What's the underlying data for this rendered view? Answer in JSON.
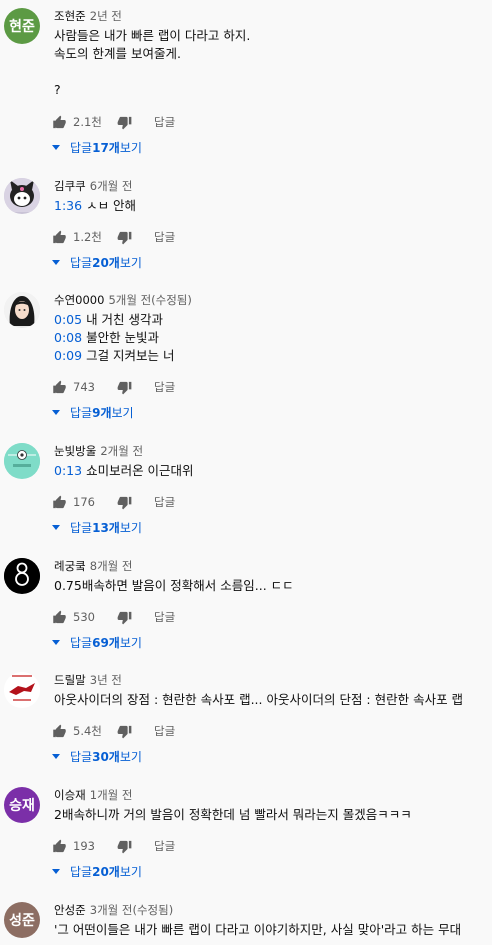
{
  "labels": {
    "reply": "답글",
    "view_replies_prefix": "답글 ",
    "view_replies_suffix": " 보기"
  },
  "colors": {
    "link": "#065fd4",
    "muted": "#606060",
    "background": "#f9f9f9"
  },
  "comments": [
    {
      "avatar_text": "현준",
      "avatar_color": "#5c9a44",
      "author": "조현준",
      "time": "2년 전",
      "lines": [
        {
          "ts": "",
          "text": "사람들은 내가 빠른 랩이 다라고 하지."
        },
        {
          "ts": "",
          "text": "속도의 한계를 보여줄게."
        },
        {
          "ts": "",
          "text": ""
        },
        {
          "ts": "",
          "text": "?"
        }
      ],
      "likes": "2.1천",
      "replies": "17개"
    },
    {
      "avatar_text": "",
      "avatar_icon": "kuromi-avatar-icon",
      "avatar_color": "#c9c3d6",
      "author": "김쿠쿠",
      "time": "6개월 전",
      "lines": [
        {
          "ts": "1:36",
          "text": "ㅅㅂ 안해"
        }
      ],
      "likes": "1.2천",
      "replies": "20개"
    },
    {
      "avatar_text": "",
      "avatar_icon": "anime-girl-avatar-icon",
      "avatar_color": "#e8e8e8",
      "author": "수연0000",
      "time": "5개월 전(수정됨)",
      "lines": [
        {
          "ts": "0:05",
          "text": "내 거친 생각과"
        },
        {
          "ts": "0:08",
          "text": "불안한 눈빛과"
        },
        {
          "ts": "0:09",
          "text": "그걸 지켜보는 너"
        }
      ],
      "likes": "743",
      "replies": "9개"
    },
    {
      "avatar_text": "",
      "avatar_icon": "soccer-ball-avatar-icon",
      "avatar_color": "#7fdcc8",
      "author": "눈빛방울",
      "time": "2개월 전",
      "lines": [
        {
          "ts": "0:13",
          "text": "쇼미보러온 이근대위"
        }
      ],
      "likes": "176",
      "replies": "13개"
    },
    {
      "avatar_text": "",
      "avatar_icon": "number-eight-avatar-icon",
      "avatar_color": "#000000",
      "author": "례궁쿸",
      "time": "8개월 전",
      "lines": [
        {
          "ts": "",
          "text": "0.75배속하면 발음이 정확해서 소름임... ㄷㄷ"
        }
      ],
      "likes": "530",
      "replies": "69개"
    },
    {
      "avatar_text": "",
      "avatar_icon": "red-creature-avatar-icon",
      "avatar_color": "#ffffff",
      "author": "드릴말",
      "time": "3년 전",
      "lines": [
        {
          "ts": "",
          "text": "아웃사이더의 장점 : 현란한 속사포 랩... 아웃사이더의 단점 : 현란한 속사포 랩"
        }
      ],
      "likes": "5.4천",
      "replies": "30개"
    },
    {
      "avatar_text": "승재",
      "avatar_color": "#7b2fa8",
      "author": "이승재",
      "time": "1개월 전",
      "lines": [
        {
          "ts": "",
          "text": "2배속하니까 거의 발음이 정확한데 넘 빨라서 뭐라는지 몰겠음ㅋㅋㅋ"
        }
      ],
      "likes": "193",
      "replies": "20개"
    },
    {
      "avatar_text": "성준",
      "avatar_color": "#8d6e63",
      "author": "안성준",
      "time": "3개월 전(수정됨)",
      "lines": [
        {
          "ts": "",
          "text": "'그 어떤이들은 내가 빠른 랩이 다라고 이야기하지만, 사실 맞아'라고 하는 무대"
        }
      ],
      "likes": "",
      "replies": ""
    }
  ]
}
